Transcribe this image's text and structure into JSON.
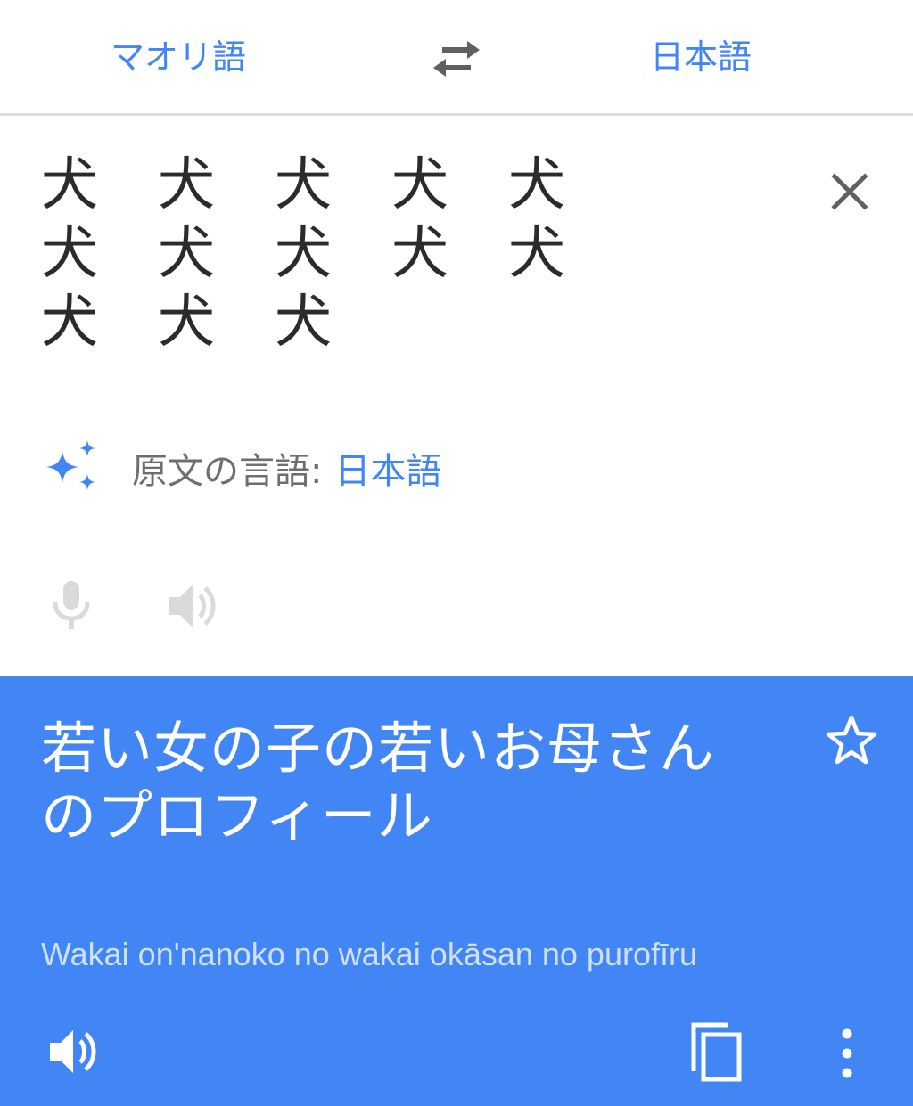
{
  "language_bar": {
    "source_language": "マオリ語",
    "target_language": "日本語",
    "swap_icon": "swap-arrows-icon"
  },
  "source": {
    "chars": [
      "犬",
      "犬",
      "犬",
      "犬",
      "犬",
      "犬",
      "犬",
      "犬",
      "犬",
      "犬",
      "犬",
      "犬",
      "犬"
    ],
    "clear_icon": "close-icon",
    "detected_label": "原文の言語:",
    "detected_language": "日本語",
    "mic_icon": "mic-icon",
    "speaker_icon": "speaker-icon"
  },
  "result": {
    "line1": "若い女の子の若いお母さん",
    "line2": "のプロフィール",
    "romanization": "Wakai on'nanoko no wakai okāsan no purofīru",
    "star_icon": "star-outline-icon",
    "speaker_icon": "speaker-icon",
    "copy_icon": "copy-icon",
    "more_icon": "more-vert-icon"
  },
  "colors": {
    "accent": "#4285f4",
    "source_text": "#2b2b2b",
    "muted": "#6e6e6e",
    "disabled_icon": "#dadada",
    "result_bg": "#4285f4",
    "result_text": "#ffffff",
    "romanization_text": "#cfe0fc"
  }
}
